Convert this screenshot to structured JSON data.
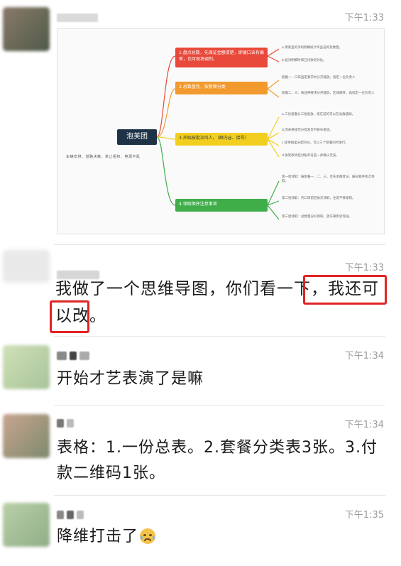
{
  "messages": [
    {
      "time": "下午1:33",
      "type": "image",
      "mindmap": {
        "center": "泡芙团",
        "subtitle": "车辆安排、道路决策、举止组织、电源不乱",
        "branches": [
          {
            "label": "1.盘点总数，先保证金额清楚，即便口诀有偏差，也可现场调剂。",
            "color": "#e8493a",
            "notes": [
              "a.用家里的手机明细统计单品名称及数量。",
              "b.核对明细时和已付款的对比。"
            ]
          },
          {
            "label": "2.总数盘完，按套餐分类",
            "color": "#f29a2e",
            "notes": [
              "套餐一：口味固定要求并分开摆放，指定一位负责人",
              "套餐二、三：按品种要求分开摆放，区域隔开，再指定一位负责人"
            ]
          },
          {
            "label": "3.开始按批次叫人。（群内@、接号）",
            "color": "#f2cf1f",
            "notes": [
              "a.三份套餐分三批发放，排在前的可以在总群通知。",
              "b.因表格规范分批发货时按号发放。",
              "c.提供群里分配叫号，可以三个套餐同时进行。",
              "d.收到款项后对账单号后一并确认无误。"
            ]
          },
          {
            "label": "4.领取顺序注意事项",
            "color": "#3fae49",
            "notes": [
              "第一批领取：报套餐一、二、三，优先本群登记，编号顺序依次领取。",
              "第二批领取：凭口味前后依次领取，注意不要拿错。",
              "第三批领取：总数量分好领取，放车辆附近等候。"
            ]
          }
        ]
      }
    },
    {
      "time": "下午1:33",
      "text": "我做了一个思维导图，你们看一下，我还可以改。"
    },
    {
      "time": "下午1:34",
      "text": "开始才艺表演了是嘛"
    },
    {
      "time": "下午1:34",
      "text": "表格：1.一份总表。2.套餐分类表3张。3.付款二维码1张。"
    },
    {
      "time": "下午1:35",
      "text": "降维打击了",
      "emoji": "crying-laughing-emoji"
    }
  ],
  "colors": {
    "highlight": "#e02424",
    "time": "#9b9b9b"
  }
}
